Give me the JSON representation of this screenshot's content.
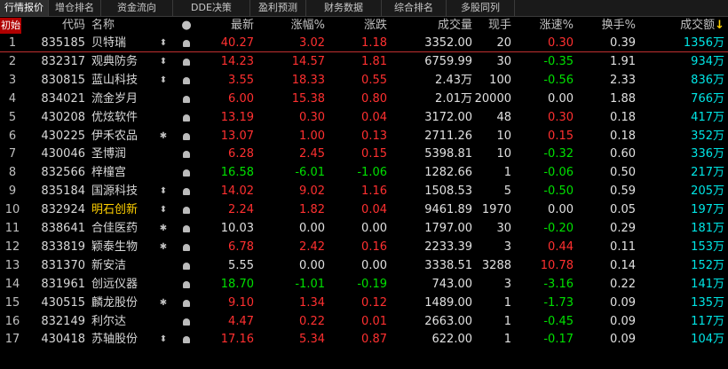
{
  "tabs": [
    "行情报价",
    "增仓排名",
    "资金流向",
    "DDE决策",
    "盈利预测",
    "财务数据",
    "综合排名",
    "多股同列"
  ],
  "init_badge": "初始",
  "headers": {
    "code": "代码",
    "name": "名称",
    "dot": "●",
    "last": "最新",
    "pct": "涨幅%",
    "chg": "涨跌",
    "vol": "成交量",
    "now": "现手",
    "spd": "涨速%",
    "turn": "换手%",
    "amt": "成交额",
    "sort": "↓"
  },
  "rows": [
    {
      "idx": "1",
      "code": "835185",
      "name": "贝特瑞",
      "f1": "⬍",
      "f2": "bell",
      "last": "40.27",
      "pct": "3.02",
      "chg": "1.18",
      "vol": "3352.00",
      "now": "20",
      "spd": "0.30",
      "turn": "0.39",
      "amt": "1356万",
      "dir": "up",
      "spd_dir": "up",
      "name_color": "white"
    },
    {
      "idx": "2",
      "code": "832317",
      "name": "观典防务",
      "f1": "⬍",
      "f2": "bell",
      "last": "14.23",
      "pct": "14.57",
      "chg": "1.81",
      "vol": "6759.99",
      "now": "30",
      "spd": "-0.35",
      "turn": "1.91",
      "amt": "934万",
      "dir": "up",
      "spd_dir": "down",
      "name_color": "white"
    },
    {
      "idx": "3",
      "code": "830815",
      "name": "蓝山科技",
      "f1": "⬍",
      "f2": "bell",
      "last": "3.55",
      "pct": "18.33",
      "chg": "0.55",
      "vol": "2.43万",
      "now": "100",
      "spd": "-0.56",
      "turn": "2.33",
      "amt": "836万",
      "dir": "up",
      "spd_dir": "down",
      "name_color": "white"
    },
    {
      "idx": "4",
      "code": "834021",
      "name": "流金岁月",
      "f1": "",
      "f2": "bell",
      "last": "6.00",
      "pct": "15.38",
      "chg": "0.80",
      "vol": "2.01万",
      "now": "20000",
      "spd": "0.00",
      "turn": "1.88",
      "amt": "766万",
      "dir": "up",
      "spd_dir": "flat",
      "name_color": "white"
    },
    {
      "idx": "5",
      "code": "430208",
      "name": "优炫软件",
      "f1": "",
      "f2": "bell",
      "last": "13.19",
      "pct": "0.30",
      "chg": "0.04",
      "vol": "3172.00",
      "now": "48",
      "spd": "0.30",
      "turn": "0.18",
      "amt": "417万",
      "dir": "up",
      "spd_dir": "up",
      "name_color": "white"
    },
    {
      "idx": "6",
      "code": "430225",
      "name": "伊禾农品",
      "f1": "✱",
      "f2": "bell",
      "last": "13.07",
      "pct": "1.00",
      "chg": "0.13",
      "vol": "2711.26",
      "now": "10",
      "spd": "0.15",
      "turn": "0.18",
      "amt": "352万",
      "dir": "up",
      "spd_dir": "up",
      "name_color": "white"
    },
    {
      "idx": "7",
      "code": "430046",
      "name": "圣博润",
      "f1": "",
      "f2": "bell",
      "last": "6.28",
      "pct": "2.45",
      "chg": "0.15",
      "vol": "5398.81",
      "now": "10",
      "spd": "-0.32",
      "turn": "0.60",
      "amt": "336万",
      "dir": "up",
      "spd_dir": "down",
      "name_color": "white"
    },
    {
      "idx": "8",
      "code": "832566",
      "name": "梓橦宫",
      "f1": "",
      "f2": "bell",
      "last": "16.58",
      "pct": "-6.01",
      "chg": "-1.06",
      "vol": "1282.66",
      "now": "1",
      "spd": "-0.06",
      "turn": "0.50",
      "amt": "217万",
      "dir": "down",
      "spd_dir": "down",
      "name_color": "white"
    },
    {
      "idx": "9",
      "code": "835184",
      "name": "国源科技",
      "f1": "⬍",
      "f2": "bell",
      "last": "14.02",
      "pct": "9.02",
      "chg": "1.16",
      "vol": "1508.53",
      "now": "5",
      "spd": "-0.50",
      "turn": "0.59",
      "amt": "205万",
      "dir": "up",
      "spd_dir": "down",
      "name_color": "white"
    },
    {
      "idx": "10",
      "code": "832924",
      "name": "明石创新",
      "f1": "⬍",
      "f2": "bell",
      "last": "2.24",
      "pct": "1.82",
      "chg": "0.04",
      "vol": "9461.89",
      "now": "1970",
      "spd": "0.00",
      "turn": "0.05",
      "amt": "197万",
      "dir": "up",
      "spd_dir": "flat",
      "name_color": "yellow"
    },
    {
      "idx": "11",
      "code": "838641",
      "name": "合佳医药",
      "f1": "✱",
      "f2": "bell",
      "last": "10.03",
      "pct": "0.00",
      "chg": "0.00",
      "vol": "1797.00",
      "now": "30",
      "spd": "-0.20",
      "turn": "0.29",
      "amt": "181万",
      "dir": "flat",
      "spd_dir": "down",
      "name_color": "white"
    },
    {
      "idx": "12",
      "code": "833819",
      "name": "颖泰生物",
      "f1": "✱",
      "f2": "bell",
      "last": "6.78",
      "pct": "2.42",
      "chg": "0.16",
      "vol": "2233.39",
      "now": "3",
      "spd": "0.44",
      "turn": "0.11",
      "amt": "153万",
      "dir": "up",
      "spd_dir": "up",
      "name_color": "white"
    },
    {
      "idx": "13",
      "code": "831370",
      "name": "新安洁",
      "f1": "",
      "f2": "bell",
      "last": "5.55",
      "pct": "0.00",
      "chg": "0.00",
      "vol": "3338.51",
      "now": "3288",
      "spd": "10.78",
      "turn": "0.14",
      "amt": "152万",
      "dir": "flat",
      "spd_dir": "up",
      "name_color": "white"
    },
    {
      "idx": "14",
      "code": "831961",
      "name": "创远仪器",
      "f1": "",
      "f2": "bell",
      "last": "18.70",
      "pct": "-1.01",
      "chg": "-0.19",
      "vol": "743.00",
      "now": "3",
      "spd": "-3.16",
      "turn": "0.22",
      "amt": "141万",
      "dir": "down",
      "spd_dir": "down",
      "name_color": "white"
    },
    {
      "idx": "15",
      "code": "430515",
      "name": "麟龙股份",
      "f1": "✱",
      "f2": "bell",
      "last": "9.10",
      "pct": "1.34",
      "chg": "0.12",
      "vol": "1489.00",
      "now": "1",
      "spd": "-1.73",
      "turn": "0.09",
      "amt": "135万",
      "dir": "up",
      "spd_dir": "down",
      "name_color": "white"
    },
    {
      "idx": "16",
      "code": "832149",
      "name": "利尔达",
      "f1": "",
      "f2": "bell",
      "last": "4.47",
      "pct": "0.22",
      "chg": "0.01",
      "vol": "2663.00",
      "now": "1",
      "spd": "-0.45",
      "turn": "0.09",
      "amt": "117万",
      "dir": "up",
      "spd_dir": "down",
      "name_color": "white"
    },
    {
      "idx": "17",
      "code": "430418",
      "name": "苏轴股份",
      "f1": "⬍",
      "f2": "bell",
      "last": "17.16",
      "pct": "5.34",
      "chg": "0.87",
      "vol": "622.00",
      "now": "1",
      "spd": "-0.17",
      "turn": "0.09",
      "amt": "104万",
      "dir": "up",
      "spd_dir": "down",
      "name_color": "white"
    }
  ]
}
